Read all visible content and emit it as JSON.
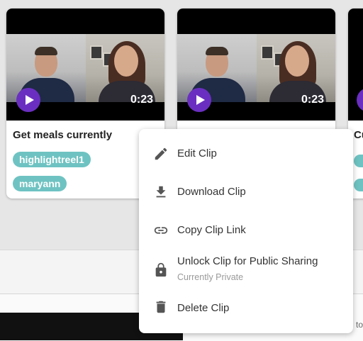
{
  "cards": [
    {
      "duration": "0:23",
      "title": "Get meals currently",
      "tags": [
        "highlightreel1",
        "maryann"
      ]
    },
    {
      "duration": "0:23"
    },
    {
      "title_partial": "Cu"
    }
  ],
  "context_menu": {
    "items": [
      {
        "label": "Edit Clip",
        "icon": "pencil-icon"
      },
      {
        "label": "Download Clip",
        "icon": "download-icon"
      },
      {
        "label": "Copy Clip Link",
        "icon": "link-icon"
      },
      {
        "label": "Unlock Clip for Public Sharing",
        "sublabel": "Currently Private",
        "icon": "lock-icon"
      },
      {
        "label": "Delete Clip",
        "icon": "trash-icon"
      }
    ]
  },
  "background": {
    "corner_text": "to"
  },
  "colors": {
    "play_button": "#6a2fc0",
    "tag": "#6ec3c2"
  }
}
